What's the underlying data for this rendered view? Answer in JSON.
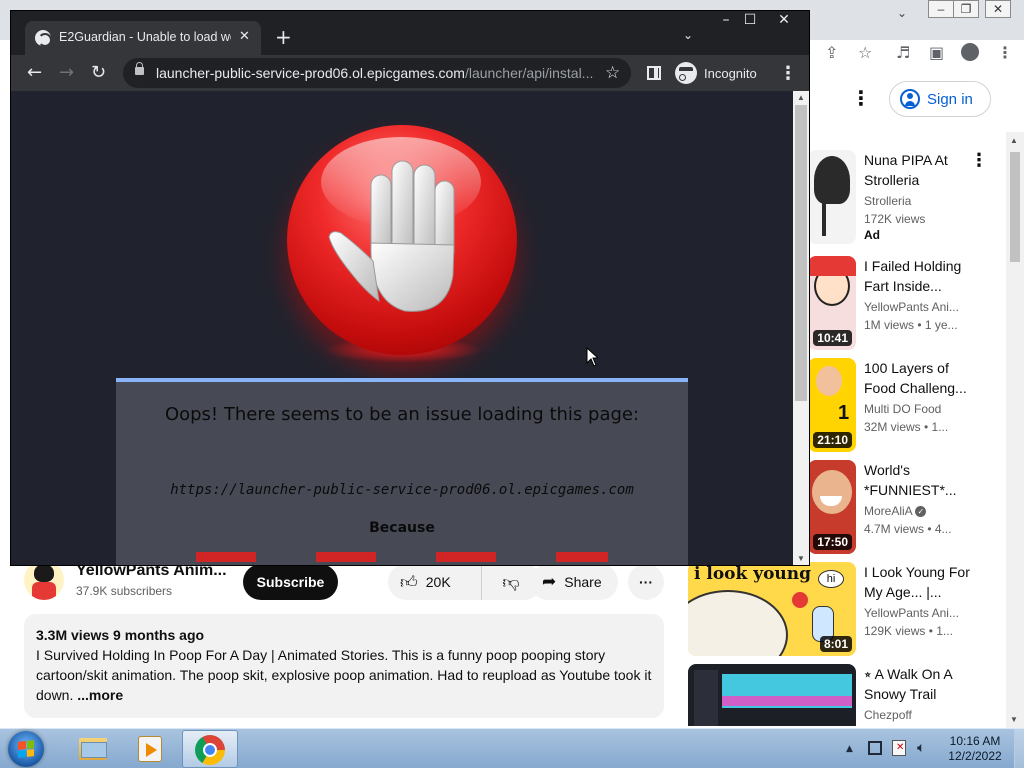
{
  "popup": {
    "tab_title": "E2Guardian - Unable to load web",
    "url_host": "launcher-public-service-prod06.ol.epicgames.com",
    "url_path": "/launcher/api/instal...",
    "incognito_label": "Incognito",
    "error_heading": "Oops! There seems to be an issue loading this page:",
    "blocked_url": "https://launcher-public-service-prod06.ol.epicgames.com",
    "because_label": "Because"
  },
  "youtube": {
    "signin_label": "Sign in",
    "channel_name": "YellowPants Anim...",
    "subscriber_count": "37.9K subscribers",
    "subscribe_label": "Subscribe",
    "like_count": "20K",
    "share_label": "Share",
    "description_stats": "3.3M views  9 months ago",
    "description_text": "I Survived Holding In Poop For A Day | Animated Stories. This is a funny poop pooping story cartoon/skit animation. The poop skit, explosive poop animation. Had to reupload as Youtube took it down.",
    "description_more": " ...more",
    "recommendations": [
      {
        "title": "Nuna PIPA At Strolleria",
        "channel": "Strolleria",
        "views": "172K views",
        "badge": "Ad",
        "duration": ""
      },
      {
        "title": "I Failed Holding Fart Inside...",
        "channel": "YellowPants Ani...",
        "views": "1M views  •  1 ye...",
        "badge": "",
        "duration": "10:41"
      },
      {
        "title": "100 Layers of Food Challeng...",
        "channel": "Multi DO Food",
        "views": "32M views  •  1...",
        "badge": "",
        "duration": "21:10"
      },
      {
        "title": "World's *FUNNIEST*...",
        "channel": "MoreAliA",
        "views": "4.7M views  •  4...",
        "badge": "",
        "duration": "17:50"
      },
      {
        "title": "I Look Young For My Age... |...",
        "channel": "YellowPants Ani...",
        "views": "129K views  •  1...",
        "badge": "",
        "duration": "8:01"
      },
      {
        "title": "⭒ A Walk On A Snowy Trail",
        "channel": "Chezpoff",
        "views": "",
        "badge": "",
        "duration": ""
      }
    ],
    "thumb_text_young": "i look young",
    "thumb_text_hi": "hi"
  },
  "taskbar": {
    "time": "10:16 AM",
    "date": "12/2/2022"
  },
  "colors": {
    "popup_bg": "#202124",
    "error_panel": "#474a55",
    "subscribe_bg": "#0f0f0f",
    "link_blue": "#065fd4",
    "stop_red": "#e01818"
  }
}
